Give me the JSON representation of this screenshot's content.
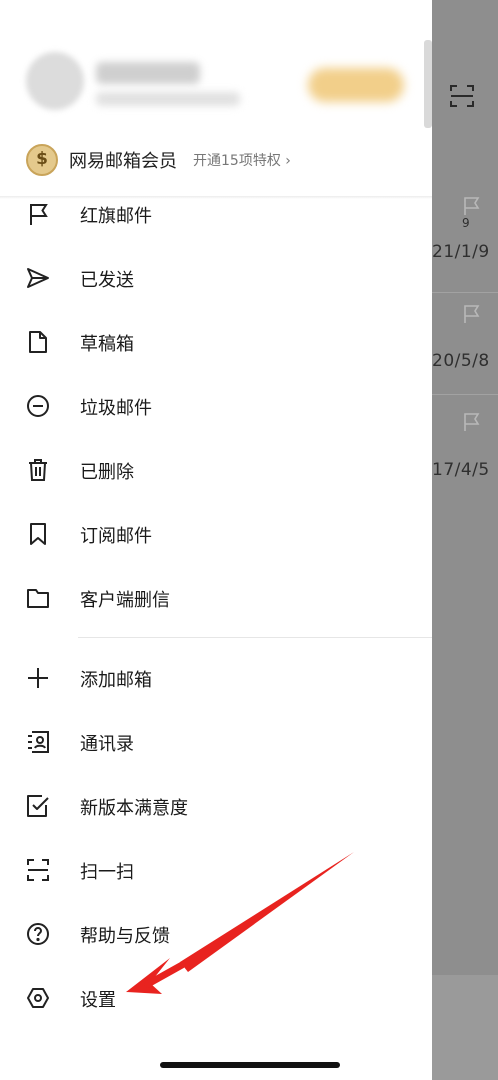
{
  "profile": {
    "vip_icon": "coin-icon",
    "vip_title": "网易邮箱会员",
    "vip_subtitle": "开通15项特权"
  },
  "menu": {
    "items": [
      {
        "label": "红旗邮件",
        "icon": "flag-icon"
      },
      {
        "label": "已发送",
        "icon": "send-icon"
      },
      {
        "label": "草稿箱",
        "icon": "draft-icon"
      },
      {
        "label": "垃圾邮件",
        "icon": "spam-icon"
      },
      {
        "label": "已删除",
        "icon": "trash-icon"
      },
      {
        "label": "订阅邮件",
        "icon": "bookmark-icon"
      },
      {
        "label": "客户端删信",
        "icon": "folder-icon"
      }
    ],
    "tools": [
      {
        "label": "添加邮箱",
        "icon": "plus-icon"
      },
      {
        "label": "通讯录",
        "icon": "contacts-icon"
      },
      {
        "label": "新版本满意度",
        "icon": "checkbox-icon"
      },
      {
        "label": "扫一扫",
        "icon": "scan-icon"
      },
      {
        "label": "帮助与反馈",
        "icon": "help-icon"
      },
      {
        "label": "设置",
        "icon": "settings-icon"
      }
    ]
  },
  "background_list": {
    "items": [
      {
        "count": "9",
        "date": "21/1/9"
      },
      {
        "date": "20/5/8"
      },
      {
        "date": "17/4/5"
      }
    ]
  },
  "annotation": {
    "color": "#e8231f"
  }
}
